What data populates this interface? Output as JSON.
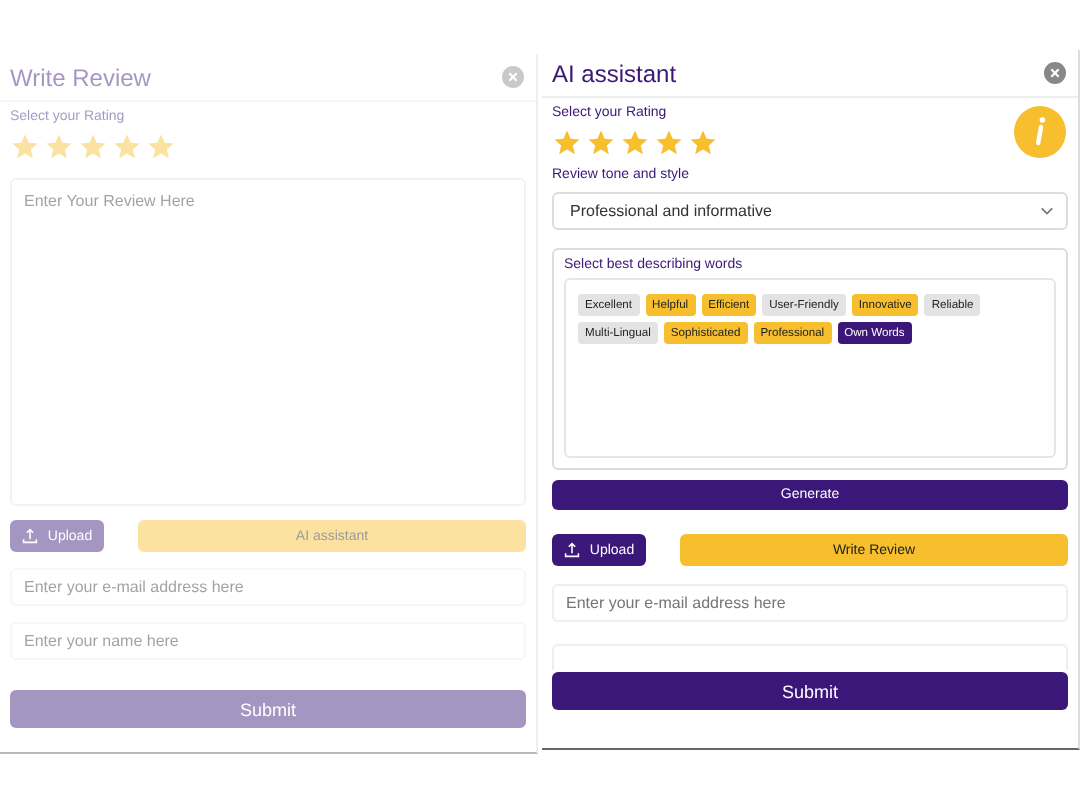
{
  "write_review": {
    "dimmed": true,
    "title": "Write Review",
    "rating_label": "Select your Rating",
    "stars": 5,
    "review_placeholder": "Enter Your Review Here",
    "upload": "Upload",
    "ai_button": "AI assistant",
    "email_placeholder": "Enter your e-mail address here",
    "name_placeholder": "Enter your name here",
    "submit": "Submit"
  },
  "ai_assistant": {
    "dimmed": false,
    "title": "AI assistant",
    "rating_label": "Select your Rating",
    "stars": 5,
    "tone_label": "Review tone and style",
    "tone_value": "Professional and informative",
    "words_label": "Select best describing words",
    "words": [
      {
        "label": "Excellent",
        "kind": "word",
        "selected": false
      },
      {
        "label": "Helpful",
        "kind": "word",
        "selected": true
      },
      {
        "label": "Efficient",
        "kind": "word",
        "selected": true
      },
      {
        "label": "User-Friendly",
        "kind": "word",
        "selected": false
      },
      {
        "label": "Innovative",
        "kind": "word",
        "selected": true
      },
      {
        "label": "Reliable",
        "kind": "word",
        "selected": false
      },
      {
        "label": "Multi-Lingual",
        "kind": "word",
        "selected": false
      },
      {
        "label": "Sophisticated",
        "kind": "word",
        "selected": true
      },
      {
        "label": "Professional",
        "kind": "word",
        "selected": true
      },
      {
        "label": "Own Words",
        "kind": "custom"
      }
    ],
    "generate": "Generate",
    "upload": "Upload",
    "write_button": "Write Review",
    "email_placeholder": "Enter your e-mail address here",
    "submit": "Submit"
  }
}
